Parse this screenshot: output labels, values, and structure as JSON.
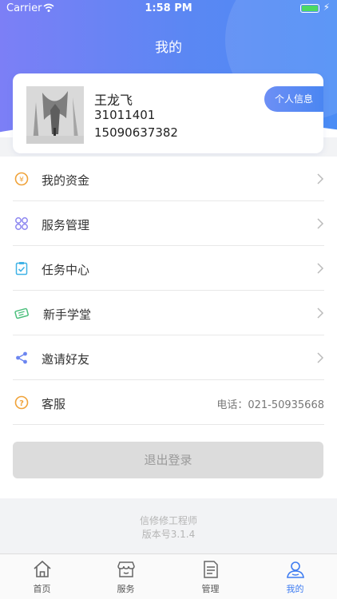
{
  "status_bar": {
    "carrier": "Carrier",
    "time": "1:58 PM"
  },
  "nav": {
    "title": "我的"
  },
  "profile": {
    "name": "王龙飞",
    "id": "31011401",
    "phone": "15090637382",
    "info_button": "个人信息"
  },
  "menu": {
    "items": [
      {
        "label": "我的资金",
        "icon": "yuan-coin-icon",
        "color": "#f0a33a"
      },
      {
        "label": "服务管理",
        "icon": "grid-cluster-icon",
        "color": "#8c86f0"
      },
      {
        "label": "任务中心",
        "icon": "clipboard-check-icon",
        "color": "#40b2e6"
      },
      {
        "label": "新手学堂",
        "icon": "ticket-icon",
        "color": "#4bbf7c"
      },
      {
        "label": "邀请好友",
        "icon": "share-icon",
        "color": "#6c86f0"
      },
      {
        "label": "客服",
        "icon": "question-circle-icon",
        "color": "#f0a33a",
        "right_text": "电话：021-50935668"
      }
    ]
  },
  "logout": {
    "label": "退出登录"
  },
  "footer": {
    "app_name": "信修修工程师",
    "version": "版本号3.1.4"
  },
  "tabbar": {
    "tabs": [
      {
        "label": "首页",
        "icon": "home-icon",
        "active": false
      },
      {
        "label": "服务",
        "icon": "store-icon",
        "active": false
      },
      {
        "label": "管理",
        "icon": "document-icon",
        "active": false
      },
      {
        "label": "我的",
        "icon": "user-icon",
        "active": true
      }
    ]
  },
  "colors": {
    "accent": "#3e7cf1",
    "header_start": "#7c7ff6",
    "header_end": "#4a8cf5"
  }
}
